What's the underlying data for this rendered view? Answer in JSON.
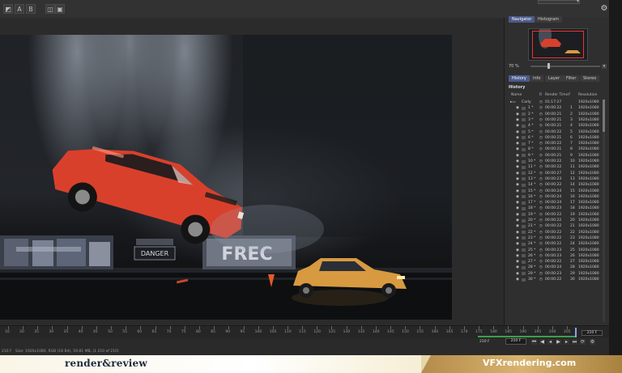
{
  "toolbar": {
    "btn_a": "A",
    "btn_b": "B"
  },
  "viewer": {
    "sign_text": "DANGER",
    "graffiti_text": "FREC"
  },
  "panel": {
    "tabs_top": [
      "Navigator",
      "Histogram"
    ],
    "zoom_label": "70 %",
    "tabs_mid": [
      "History",
      "Info",
      "Layer",
      "Filter",
      "Stereo"
    ],
    "history_title": "History",
    "columns": {
      "name": "Name",
      "r": "R",
      "render_time": "Render Time",
      "f": "F",
      "resolution": "Resolution"
    },
    "root": {
      "name": "Carly",
      "time": "01:17:27",
      "res": "1920x1080"
    },
    "rows": [
      {
        "n": "1 *",
        "t": "00:00:22",
        "f": "1",
        "r": "1920x1080"
      },
      {
        "n": "2 *",
        "t": "00:00:21",
        "f": "2",
        "r": "1920x1080"
      },
      {
        "n": "3 *",
        "t": "00:00:21",
        "f": "3",
        "r": "1920x1080"
      },
      {
        "n": "4 *",
        "t": "00:00:21",
        "f": "4",
        "r": "1920x1080"
      },
      {
        "n": "5 *",
        "t": "00:00:22",
        "f": "5",
        "r": "1920x1080"
      },
      {
        "n": "6 *",
        "t": "00:00:21",
        "f": "6",
        "r": "1920x1080"
      },
      {
        "n": "7 *",
        "t": "00:00:22",
        "f": "7",
        "r": "1920x1080"
      },
      {
        "n": "8 *",
        "t": "00:00:21",
        "f": "8",
        "r": "1920x1080"
      },
      {
        "n": "9 *",
        "t": "00:00:21",
        "f": "9",
        "r": "1920x1080"
      },
      {
        "n": "10 *",
        "t": "00:00:22",
        "f": "10",
        "r": "1920x1080"
      },
      {
        "n": "11 *",
        "t": "00:00:22",
        "f": "11",
        "r": "1920x1080"
      },
      {
        "n": "12 *",
        "t": "00:00:27",
        "f": "12",
        "r": "1920x1080"
      },
      {
        "n": "13 *",
        "t": "00:00:23",
        "f": "13",
        "r": "1920x1080"
      },
      {
        "n": "14 *",
        "t": "00:00:22",
        "f": "14",
        "r": "1920x1080"
      },
      {
        "n": "15 *",
        "t": "00:00:24",
        "f": "15",
        "r": "1920x1080"
      },
      {
        "n": "16 *",
        "t": "00:00:24",
        "f": "16",
        "r": "1920x1080"
      },
      {
        "n": "17 *",
        "t": "00:00:24",
        "f": "17",
        "r": "1920x1080"
      },
      {
        "n": "18 *",
        "t": "00:00:23",
        "f": "18",
        "r": "1920x1080"
      },
      {
        "n": "19 *",
        "t": "00:00:22",
        "f": "19",
        "r": "1920x1080"
      },
      {
        "n": "20 *",
        "t": "00:00:22",
        "f": "20",
        "r": "1920x1080"
      },
      {
        "n": "21 *",
        "t": "00:00:22",
        "f": "21",
        "r": "1920x1080"
      },
      {
        "n": "22 *",
        "t": "00:00:22",
        "f": "22",
        "r": "1920x1080"
      },
      {
        "n": "23 *",
        "t": "00:00:22",
        "f": "23",
        "r": "1920x1080"
      },
      {
        "n": "24 *",
        "t": "00:00:22",
        "f": "24",
        "r": "1920x1080"
      },
      {
        "n": "25 *",
        "t": "00:00:23",
        "f": "25",
        "r": "1920x1080"
      },
      {
        "n": "26 *",
        "t": "00:00:23",
        "f": "26",
        "r": "1920x1080"
      },
      {
        "n": "27 *",
        "t": "00:00:22",
        "f": "27",
        "r": "1920x1080"
      },
      {
        "n": "28 *",
        "t": "00:00:24",
        "f": "28",
        "r": "1920x1080"
      },
      {
        "n": "29 *",
        "t": "00:00:23",
        "f": "29",
        "r": "1920x1080"
      },
      {
        "n": "30 *",
        "t": "00:00:22",
        "f": "30",
        "r": "1920x1080"
      }
    ]
  },
  "timeline": {
    "ticks": [
      "10",
      "20",
      "25",
      "30",
      "35",
      "40",
      "45",
      "50",
      "55",
      "60",
      "65",
      "70",
      "75",
      "80",
      "85",
      "90",
      "95",
      "100",
      "105",
      "110",
      "115",
      "120",
      "125",
      "130",
      "135",
      "140",
      "145",
      "150",
      "155",
      "160",
      "165",
      "170",
      "175",
      "180",
      "185",
      "190",
      "195",
      "200",
      "205"
    ],
    "frame_value": "210 F"
  },
  "status": {
    "left_frame": "210 F",
    "info": "Size: 1920x1080, RGB (16 Bit), 59.81 MB, (1 210 of 210)",
    "frames_label": "210 F",
    "frame_field": "210 F"
  },
  "banner": {
    "left_logo": "render&review",
    "right_logo": "VFXrendering.com"
  },
  "colors": {
    "active_tab": "#4b5a8a",
    "range_bar": "#3aa04a",
    "playhead": "#8ba3e6",
    "car_red": "#d9402c",
    "car_yellow": "#e0a94a"
  }
}
